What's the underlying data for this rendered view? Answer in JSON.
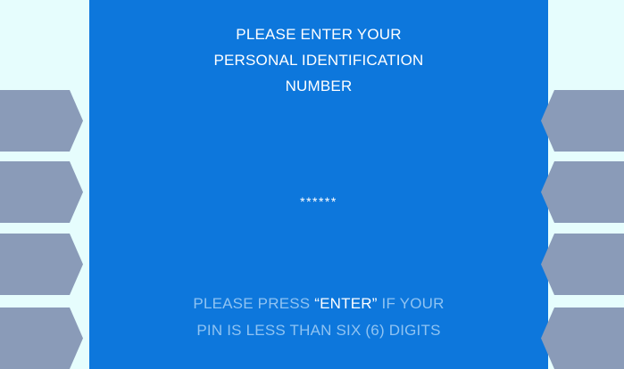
{
  "screen": {
    "prompt_lines": [
      "PLEASE ENTER YOUR",
      "PERSONAL IDENTIFICATION",
      "NUMBER"
    ],
    "pin_mask": "******",
    "note": {
      "line1_prefix": "PLEASE PRESS ",
      "open_quote": "“",
      "highlight": "ENTER",
      "close_quote": "”",
      "line1_suffix": " IF YOUR",
      "line2": "PIN IS LESS THAN SIX (6) DIGITS"
    }
  },
  "colors": {
    "background": "#e6fdfd",
    "screen": "#0d77dc",
    "softkey": "#8a9bb8",
    "text": "#ffffff",
    "note_text": "#8fc3f2"
  },
  "icons": {
    "left_softkeys": "arrow-right-softkey",
    "right_softkeys": "arrow-left-softkey"
  }
}
